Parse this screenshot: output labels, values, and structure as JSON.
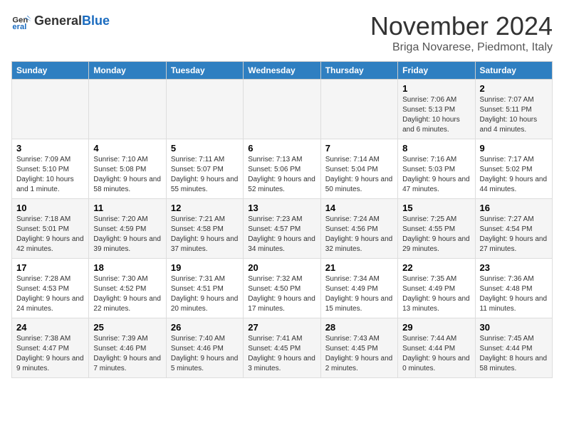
{
  "logo": {
    "text_general": "General",
    "text_blue": "Blue"
  },
  "header": {
    "month": "November 2024",
    "location": "Briga Novarese, Piedmont, Italy"
  },
  "weekdays": [
    "Sunday",
    "Monday",
    "Tuesday",
    "Wednesday",
    "Thursday",
    "Friday",
    "Saturday"
  ],
  "weeks": [
    [
      {
        "day": "",
        "info": ""
      },
      {
        "day": "",
        "info": ""
      },
      {
        "day": "",
        "info": ""
      },
      {
        "day": "",
        "info": ""
      },
      {
        "day": "",
        "info": ""
      },
      {
        "day": "1",
        "info": "Sunrise: 7:06 AM\nSunset: 5:13 PM\nDaylight: 10 hours\nand 6 minutes."
      },
      {
        "day": "2",
        "info": "Sunrise: 7:07 AM\nSunset: 5:11 PM\nDaylight: 10 hours\nand 4 minutes."
      }
    ],
    [
      {
        "day": "3",
        "info": "Sunrise: 7:09 AM\nSunset: 5:10 PM\nDaylight: 10 hours\nand 1 minute."
      },
      {
        "day": "4",
        "info": "Sunrise: 7:10 AM\nSunset: 5:08 PM\nDaylight: 9 hours\nand 58 minutes."
      },
      {
        "day": "5",
        "info": "Sunrise: 7:11 AM\nSunset: 5:07 PM\nDaylight: 9 hours\nand 55 minutes."
      },
      {
        "day": "6",
        "info": "Sunrise: 7:13 AM\nSunset: 5:06 PM\nDaylight: 9 hours\nand 52 minutes."
      },
      {
        "day": "7",
        "info": "Sunrise: 7:14 AM\nSunset: 5:04 PM\nDaylight: 9 hours\nand 50 minutes."
      },
      {
        "day": "8",
        "info": "Sunrise: 7:16 AM\nSunset: 5:03 PM\nDaylight: 9 hours\nand 47 minutes."
      },
      {
        "day": "9",
        "info": "Sunrise: 7:17 AM\nSunset: 5:02 PM\nDaylight: 9 hours\nand 44 minutes."
      }
    ],
    [
      {
        "day": "10",
        "info": "Sunrise: 7:18 AM\nSunset: 5:01 PM\nDaylight: 9 hours\nand 42 minutes."
      },
      {
        "day": "11",
        "info": "Sunrise: 7:20 AM\nSunset: 4:59 PM\nDaylight: 9 hours\nand 39 minutes."
      },
      {
        "day": "12",
        "info": "Sunrise: 7:21 AM\nSunset: 4:58 PM\nDaylight: 9 hours\nand 37 minutes."
      },
      {
        "day": "13",
        "info": "Sunrise: 7:23 AM\nSunset: 4:57 PM\nDaylight: 9 hours\nand 34 minutes."
      },
      {
        "day": "14",
        "info": "Sunrise: 7:24 AM\nSunset: 4:56 PM\nDaylight: 9 hours\nand 32 minutes."
      },
      {
        "day": "15",
        "info": "Sunrise: 7:25 AM\nSunset: 4:55 PM\nDaylight: 9 hours\nand 29 minutes."
      },
      {
        "day": "16",
        "info": "Sunrise: 7:27 AM\nSunset: 4:54 PM\nDaylight: 9 hours\nand 27 minutes."
      }
    ],
    [
      {
        "day": "17",
        "info": "Sunrise: 7:28 AM\nSunset: 4:53 PM\nDaylight: 9 hours\nand 24 minutes."
      },
      {
        "day": "18",
        "info": "Sunrise: 7:30 AM\nSunset: 4:52 PM\nDaylight: 9 hours\nand 22 minutes."
      },
      {
        "day": "19",
        "info": "Sunrise: 7:31 AM\nSunset: 4:51 PM\nDaylight: 9 hours\nand 20 minutes."
      },
      {
        "day": "20",
        "info": "Sunrise: 7:32 AM\nSunset: 4:50 PM\nDaylight: 9 hours\nand 17 minutes."
      },
      {
        "day": "21",
        "info": "Sunrise: 7:34 AM\nSunset: 4:49 PM\nDaylight: 9 hours\nand 15 minutes."
      },
      {
        "day": "22",
        "info": "Sunrise: 7:35 AM\nSunset: 4:49 PM\nDaylight: 9 hours\nand 13 minutes."
      },
      {
        "day": "23",
        "info": "Sunrise: 7:36 AM\nSunset: 4:48 PM\nDaylight: 9 hours\nand 11 minutes."
      }
    ],
    [
      {
        "day": "24",
        "info": "Sunrise: 7:38 AM\nSunset: 4:47 PM\nDaylight: 9 hours\nand 9 minutes."
      },
      {
        "day": "25",
        "info": "Sunrise: 7:39 AM\nSunset: 4:46 PM\nDaylight: 9 hours\nand 7 minutes."
      },
      {
        "day": "26",
        "info": "Sunrise: 7:40 AM\nSunset: 4:46 PM\nDaylight: 9 hours\nand 5 minutes."
      },
      {
        "day": "27",
        "info": "Sunrise: 7:41 AM\nSunset: 4:45 PM\nDaylight: 9 hours\nand 3 minutes."
      },
      {
        "day": "28",
        "info": "Sunrise: 7:43 AM\nSunset: 4:45 PM\nDaylight: 9 hours\nand 2 minutes."
      },
      {
        "day": "29",
        "info": "Sunrise: 7:44 AM\nSunset: 4:44 PM\nDaylight: 9 hours\nand 0 minutes."
      },
      {
        "day": "30",
        "info": "Sunrise: 7:45 AM\nSunset: 4:44 PM\nDaylight: 8 hours\nand 58 minutes."
      }
    ]
  ]
}
